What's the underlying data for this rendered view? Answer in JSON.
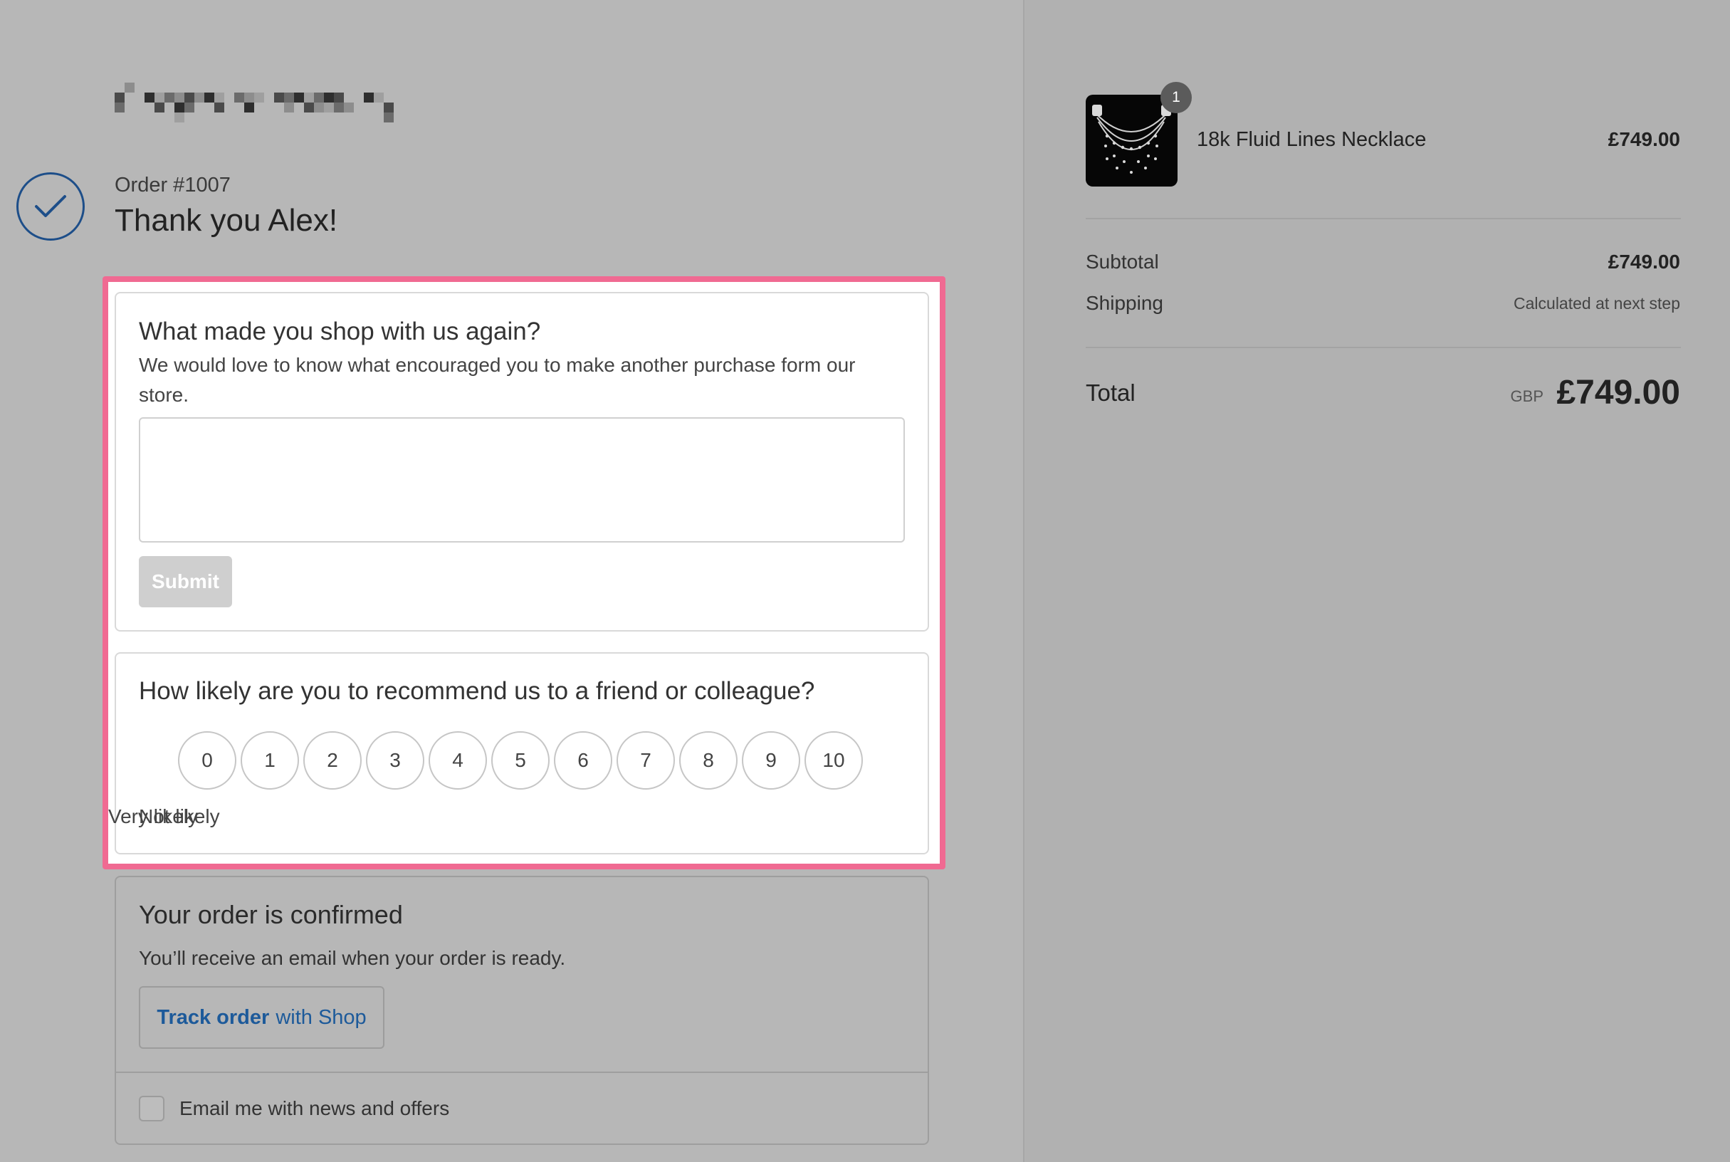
{
  "order": {
    "number": "Order #1007",
    "thank_you": "Thank you Alex!"
  },
  "survey": {
    "question1_title": "What made you shop with us again?",
    "question1_desc": "We would love to know what encouraged you to make another purchase form our store.",
    "feedback_value": "",
    "submit_label": "Submit",
    "question2_title": "How likely are you to recommend us to a friend or colleague?",
    "scale": [
      "0",
      "1",
      "2",
      "3",
      "4",
      "5",
      "6",
      "7",
      "8",
      "9",
      "10"
    ],
    "low_label": "Not likely",
    "high_label": "Very likely"
  },
  "confirmation": {
    "title": "Your order is confirmed",
    "text": "You’ll receive an email when your order is ready.",
    "track_bold": "Track order",
    "track_rest": "with Shop",
    "newsletter_label": "Email me with news and offers"
  },
  "summary": {
    "product_name": "18k Fluid Lines Necklace",
    "product_price": "£749.00",
    "quantity": "1",
    "subtotal_label": "Subtotal",
    "subtotal_value": "£749.00",
    "shipping_label": "Shipping",
    "shipping_value": "Calculated at next step",
    "total_label": "Total",
    "currency": "GBP",
    "total_value": "£749.00"
  },
  "colors": {
    "highlight": "#f06a92",
    "accent": "#1d4e89",
    "link": "#1d5a9a"
  },
  "icons": [
    "check-icon",
    "necklace-thumbnail",
    "checkbox-icon"
  ]
}
